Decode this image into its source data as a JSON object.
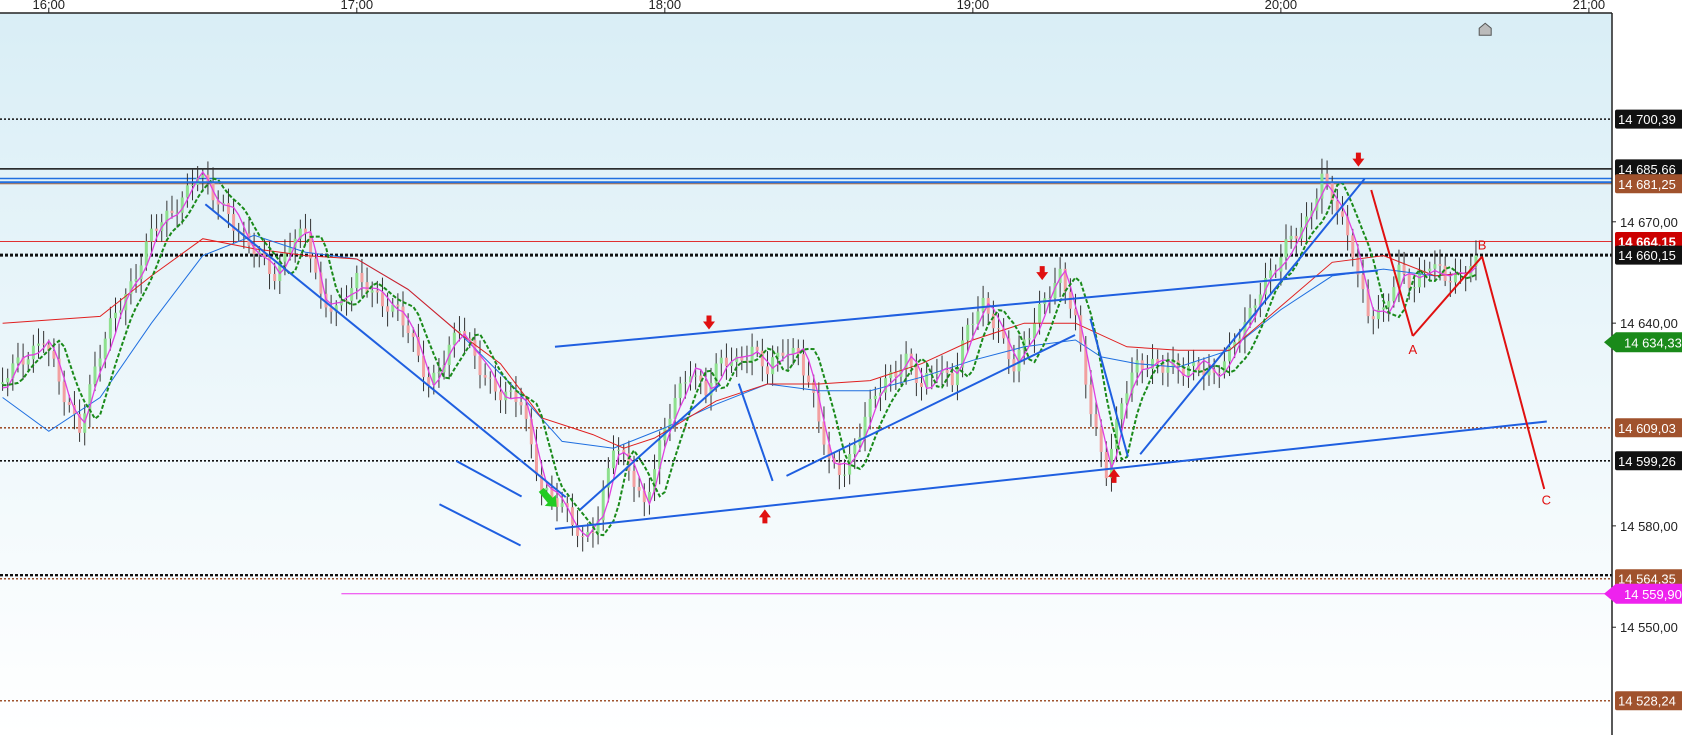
{
  "colors": {
    "up_candle": "#8ee08e",
    "down_candle": "#f2a0a0",
    "wick": "#333333",
    "ema_fast": "#e040e0",
    "ema_mid": "#1a8a1a",
    "ema_slow": "#1f6fe0",
    "ema_red": "#e02020",
    "trend_line": "#1f5fe0",
    "wave_line": "#e01010",
    "signal_arrow": "#e01010",
    "buy_arrow": "#22cc22"
  },
  "chart_data": {
    "type": "candlestick",
    "x_ticks": [
      "16:00",
      "17:00",
      "18:00",
      "19:00",
      "20:00",
      "21:00"
    ],
    "x_ticks_min": [
      0,
      60,
      120,
      180,
      240,
      300
    ],
    "x_range_min": [
      -9.5,
      304.5
    ],
    "y_range": [
      14518.1,
      14731.8
    ],
    "y_ticks": [
      {
        "value": 14670.0,
        "label": "14 670,00"
      },
      {
        "value": 14640.0,
        "label": "14 640,00"
      },
      {
        "value": 14580.0,
        "label": "14 580,00"
      },
      {
        "value": 14550.0,
        "label": "14 550,00"
      }
    ],
    "price_levels": [
      {
        "value": 14700.39,
        "label": "14 700,39",
        "style": "dotted",
        "color": "#111111",
        "badge_bg": "#111111",
        "badge_fg": "#ffffff"
      },
      {
        "value": 14685.66,
        "label": "14 685,66",
        "style": "solid",
        "color": "#111111",
        "badge_bg": "#111111",
        "badge_fg": "#ffffff"
      },
      {
        "value": 14681.25,
        "label": "14 681,25",
        "style": "solid",
        "color": "#b0602a",
        "badge_bg": "#a0522d",
        "badge_fg": "#ffffff"
      },
      {
        "value": 14664.15,
        "label": "14 664,15",
        "style": "solid",
        "color": "#e03030",
        "badge_bg": "#cc0000",
        "badge_fg": "#ffffff"
      },
      {
        "value": 14660.15,
        "label": "14 660,15",
        "style": "dotted-bold",
        "color": "#111111",
        "badge_bg": "#111111",
        "badge_fg": "#ffffff"
      },
      {
        "value": 14634.33,
        "label": "14 634,33",
        "style": "none",
        "color": "#1a8a1a",
        "badge_bg": "#1a8a1a",
        "badge_fg": "#ffffff"
      },
      {
        "value": 14609.03,
        "label": "14 609,03",
        "style": "dotted",
        "color": "#a0522d",
        "badge_bg": "#a0522d",
        "badge_fg": "#ffffff"
      },
      {
        "value": 14599.26,
        "label": "14 599,26",
        "style": "dotted",
        "color": "#111111",
        "badge_bg": "#111111",
        "badge_fg": "#ffffff"
      },
      {
        "value": 14564.35,
        "label": "14 564,35",
        "style": "dotted",
        "color": "#a0522d",
        "badge_bg": "#a0522d",
        "badge_fg": "#ffffff"
      },
      {
        "value": 14559.9,
        "label": "14 559,90",
        "style": "solid",
        "color": "#ee33ee",
        "badge_bg": "#ee22ee",
        "badge_fg": "#ffffff",
        "from_min": 57
      },
      {
        "value": 14528.24,
        "label": "14 528,24",
        "style": "dotted",
        "color": "#a0522d",
        "badge_bg": "#a0522d",
        "badge_fg": "#ffffff"
      }
    ],
    "hidden_level": {
      "value": 14565.4
    },
    "blue_level": {
      "value": 14682.8
    },
    "candle_anchors": [
      [
        -9,
        14622
      ],
      [
        -6,
        14629
      ],
      [
        -1,
        14635
      ],
      [
        3,
        14618
      ],
      [
        6,
        14610
      ],
      [
        9,
        14626
      ],
      [
        13,
        14643
      ],
      [
        17,
        14655
      ],
      [
        20,
        14666
      ],
      [
        24,
        14673
      ],
      [
        26,
        14678
      ],
      [
        29,
        14684
      ],
      [
        32,
        14677
      ],
      [
        35,
        14673
      ],
      [
        38,
        14665
      ],
      [
        41,
        14659
      ],
      [
        44,
        14654
      ],
      [
        47,
        14665
      ],
      [
        50,
        14666
      ],
      [
        53,
        14647
      ],
      [
        56,
        14645
      ],
      [
        60,
        14652
      ],
      [
        64,
        14648
      ],
      [
        68,
        14644
      ],
      [
        71,
        14633
      ],
      [
        74,
        14622
      ],
      [
        77,
        14630
      ],
      [
        80,
        14638
      ],
      [
        84,
        14627
      ],
      [
        88,
        14619
      ],
      [
        92,
        14616
      ],
      [
        96,
        14592
      ],
      [
        100,
        14585
      ],
      [
        104,
        14576
      ],
      [
        107,
        14583
      ],
      [
        110,
        14603
      ],
      [
        113,
        14597
      ],
      [
        116,
        14587
      ],
      [
        119,
        14603
      ],
      [
        122,
        14617
      ],
      [
        125,
        14627
      ],
      [
        128,
        14620
      ],
      [
        131,
        14628
      ],
      [
        134,
        14629
      ],
      [
        137,
        14633
      ],
      [
        140,
        14625
      ],
      [
        143,
        14632
      ],
      [
        146,
        14632
      ],
      [
        149,
        14617
      ],
      [
        152,
        14598
      ],
      [
        155,
        14597
      ],
      [
        158,
        14608
      ],
      [
        161,
        14618
      ],
      [
        164,
        14625
      ],
      [
        167,
        14630
      ],
      [
        170,
        14620
      ],
      [
        173,
        14627
      ],
      [
        176,
        14624
      ],
      [
        179,
        14638
      ],
      [
        182,
        14645
      ],
      [
        185,
        14639
      ],
      [
        188,
        14627
      ],
      [
        191,
        14636
      ],
      [
        194,
        14648
      ],
      [
        197,
        14655
      ],
      [
        200,
        14640
      ],
      [
        203,
        14614
      ],
      [
        206,
        14597
      ],
      [
        209,
        14616
      ],
      [
        212,
        14627
      ],
      [
        215,
        14629
      ],
      [
        218,
        14627
      ],
      [
        221,
        14625
      ],
      [
        224,
        14628
      ],
      [
        227,
        14625
      ],
      [
        230,
        14630
      ],
      [
        233,
        14640
      ],
      [
        236,
        14651
      ],
      [
        239,
        14656
      ],
      [
        242,
        14665
      ],
      [
        245,
        14671
      ],
      [
        248,
        14683
      ],
      [
        251,
        14673
      ],
      [
        254,
        14662
      ],
      [
        257,
        14643
      ],
      [
        260,
        14642
      ],
      [
        263,
        14656
      ],
      [
        266,
        14652
      ],
      [
        269,
        14657
      ],
      [
        272,
        14653
      ],
      [
        275,
        14655
      ],
      [
        277,
        14658
      ]
    ],
    "ema_slow": [
      [
        -9,
        14618
      ],
      [
        0,
        14608
      ],
      [
        10,
        14618
      ],
      [
        20,
        14640
      ],
      [
        30,
        14660
      ],
      [
        40,
        14666
      ],
      [
        50,
        14661
      ],
      [
        60,
        14659
      ],
      [
        70,
        14650
      ],
      [
        80,
        14637
      ],
      [
        90,
        14622
      ],
      [
        100,
        14605
      ],
      [
        110,
        14603
      ],
      [
        120,
        14609
      ],
      [
        130,
        14616
      ],
      [
        140,
        14622
      ],
      [
        150,
        14620
      ],
      [
        160,
        14620
      ],
      [
        170,
        14624
      ],
      [
        180,
        14629
      ],
      [
        190,
        14633
      ],
      [
        200,
        14635
      ],
      [
        205,
        14630
      ],
      [
        212,
        14628
      ],
      [
        220,
        14627
      ],
      [
        230,
        14632
      ],
      [
        240,
        14644
      ],
      [
        250,
        14654
      ],
      [
        260,
        14656
      ],
      [
        270,
        14654
      ],
      [
        277,
        14655
      ]
    ],
    "ema_red": [
      [
        -9,
        14640
      ],
      [
        10,
        14642
      ],
      [
        20,
        14654
      ],
      [
        30,
        14665
      ],
      [
        40,
        14662
      ],
      [
        50,
        14660
      ],
      [
        60,
        14659
      ],
      [
        70,
        14650
      ],
      [
        80,
        14637
      ],
      [
        88,
        14628
      ],
      [
        96,
        14612
      ],
      [
        106,
        14607
      ],
      [
        112,
        14603
      ],
      [
        118,
        14606
      ],
      [
        130,
        14617
      ],
      [
        140,
        14622
      ],
      [
        150,
        14622
      ],
      [
        160,
        14623
      ],
      [
        170,
        14628
      ],
      [
        180,
        14635
      ],
      [
        190,
        14640
      ],
      [
        200,
        14640
      ],
      [
        210,
        14633
      ],
      [
        220,
        14632
      ],
      [
        230,
        14632
      ],
      [
        240,
        14645
      ],
      [
        250,
        14658
      ],
      [
        260,
        14660
      ],
      [
        270,
        14654
      ],
      [
        277,
        14655
      ]
    ],
    "trend_lines": [
      {
        "p1": [
          -9.5,
          14681.7
        ],
        "p2": [
          304.5,
          14681.7
        ],
        "color": "#1f6fe0"
      },
      {
        "p1": [
          30.5,
          14675.2
        ],
        "p2": [
          100.7,
          14588.5
        ],
        "color": "#1f5fe0"
      },
      {
        "p1": [
          76.1,
          14586.4
        ],
        "p2": [
          91.9,
          14574.2
        ],
        "color": "#1f5fe0"
      },
      {
        "p1": [
          79.4,
          14599.2
        ],
        "p2": [
          92.1,
          14588.7
        ],
        "color": "#1f5fe0"
      },
      {
        "p1": [
          98.6,
          14579.1
        ],
        "p2": [
          291.8,
          14610.9
        ],
        "color": "#1f5fe0"
      },
      {
        "p1": [
          98.6,
          14633.0
        ],
        "p2": [
          258.9,
          14655.6
        ],
        "color": "#1f5fe0"
      },
      {
        "p1": [
          103.5,
          14584.8
        ],
        "p2": [
          130.6,
          14621.7
        ],
        "color": "#1f5fe0"
      },
      {
        "p1": [
          134.4,
          14622.1
        ],
        "p2": [
          141.0,
          14593.3
        ],
        "color": "#1f5fe0"
      },
      {
        "p1": [
          143.7,
          14594.8
        ],
        "p2": [
          199.9,
          14636.5
        ],
        "color": "#1f5fe0"
      },
      {
        "p1": [
          202.9,
          14641.3
        ],
        "p2": [
          210.2,
          14600.5
        ],
        "color": "#1f5fe0"
      },
      {
        "p1": [
          212.6,
          14601.2
        ],
        "p2": [
          256.3,
          14682.7
        ],
        "color": "#1f5fe0"
      }
    ],
    "wave": {
      "points": [
        [
          257.6,
          14679.4
        ],
        [
          265.7,
          14636.2
        ],
        [
          279.2,
          14659.7
        ],
        [
          291.3,
          14590.9
        ]
      ],
      "labels": [
        {
          "text": "A",
          "at": [
            265.7,
            14632.0
          ]
        },
        {
          "text": "B",
          "at": [
            279.2,
            14663.0
          ]
        },
        {
          "text": "C",
          "at": [
            291.7,
            14587.5
          ]
        }
      ]
    },
    "down_arrows": [
      [
        128.6,
        14640.2
      ],
      [
        193.5,
        14654.8
      ],
      [
        255.1,
        14688.4
      ]
    ],
    "up_arrows": [
      [
        139.5,
        14582.8
      ],
      [
        207.5,
        14594.8
      ]
    ],
    "buy_arrow_at": [
      97.0,
      14586.5
    ],
    "marker_at": [
      279.8,
      14727.0
    ]
  }
}
